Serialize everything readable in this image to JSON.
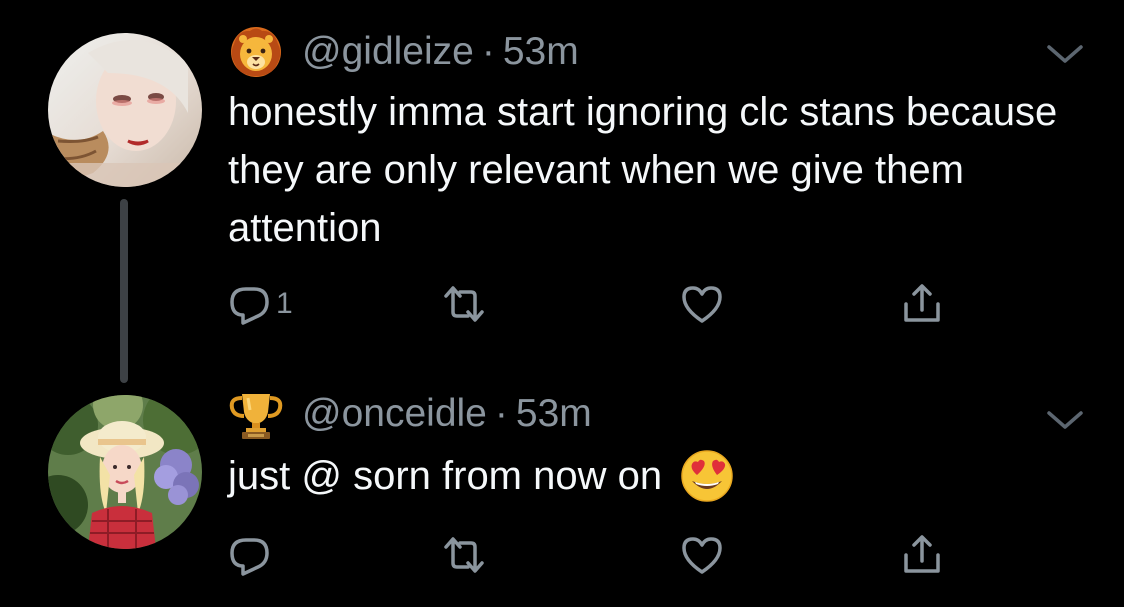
{
  "colors": {
    "background": "#000000",
    "text": "#f5f8fa",
    "muted": "#8b959e",
    "thread_line": "#3d4145"
  },
  "tweets": [
    {
      "badge_icon": "lion-emoji-icon",
      "handle": "@gidleize",
      "separator": "·",
      "time": "53m",
      "text": "honestly imma start ignoring clc stans because they are only relevant when we give them attention",
      "reply_count": "1"
    },
    {
      "badge_icon": "trophy-emoji-icon",
      "handle": "@onceidle",
      "separator": "·",
      "time": "53m",
      "text": "just @ sorn from now on",
      "trailing_emoji": "heart-eyes-emoji-icon",
      "reply_count": ""
    }
  ],
  "icons": {
    "reply": "reply-icon",
    "retweet": "retweet-icon",
    "like": "heart-icon",
    "share": "share-icon",
    "menu": "chevron-down-icon"
  }
}
